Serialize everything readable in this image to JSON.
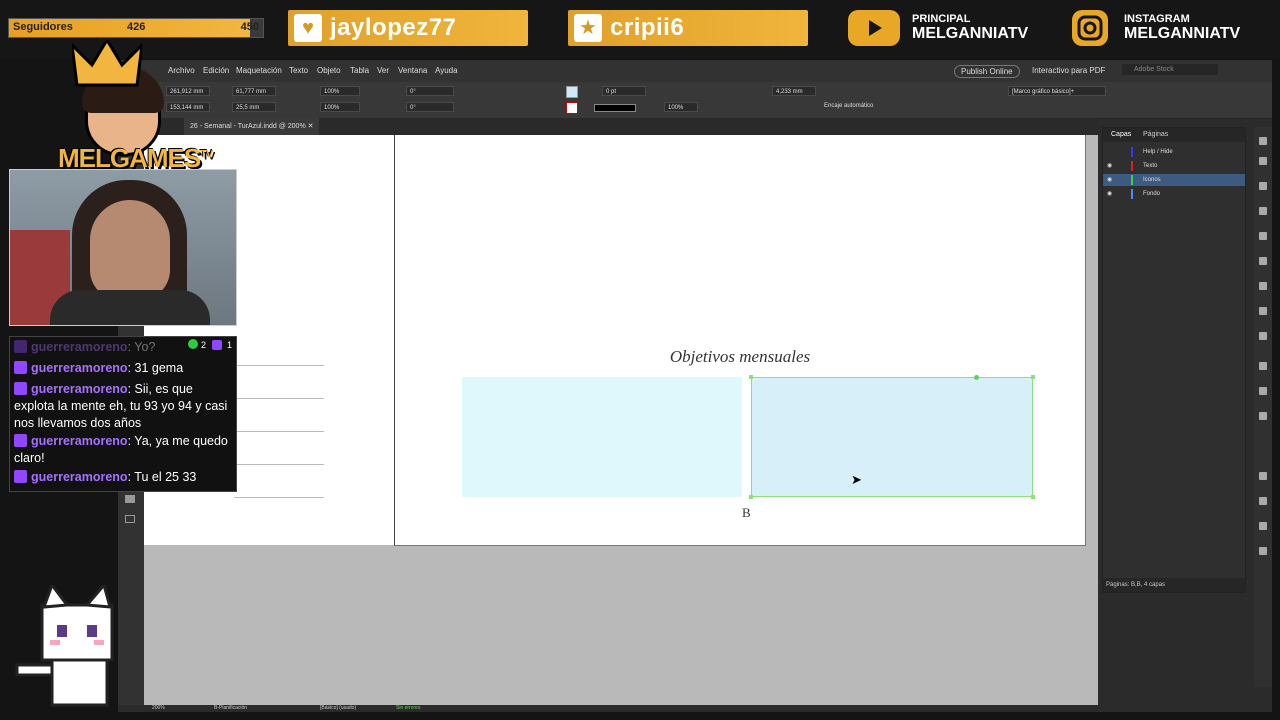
{
  "overlay": {
    "followers": {
      "label": "Seguidores",
      "current": "426",
      "goal": "450",
      "progress": 0.947
    },
    "highlight1": "jaylopez77",
    "highlight2": "cripii6",
    "youtube": {
      "sub": "PRINCIPAL",
      "main": "MELGANNIATV"
    },
    "instagram": {
      "sub": "INSTAGRAM",
      "main": "MELGANNIATV"
    },
    "logo_text": "MELGAMES",
    "logo_tv": "TV"
  },
  "chat": {
    "badges": {
      "mods": "2",
      "subs": "1"
    },
    "messages": [
      {
        "user": "guerreramoreno",
        "text": "Yo?"
      },
      {
        "user": "guerreramoreno",
        "text": "31 gema"
      },
      {
        "user": "guerreramoreno",
        "text": "Sii, es que explota la mente eh, tu 93 yo 94 y casi nos llevamos dos años"
      },
      {
        "user": "guerreramoreno",
        "text": "Ya, ya me quedo claro!"
      },
      {
        "user": "guerreramoreno",
        "text": "Tu el 25 33"
      }
    ]
  },
  "app": {
    "menu": [
      "Archivo",
      "Edición",
      "Maquetación",
      "Texto",
      "Objeto",
      "Tabla",
      "Ver",
      "Ventana",
      "Ayuda"
    ],
    "publish": "Publish Online",
    "workspace": "Interactivo para PDF",
    "search_placeholder": "Adobe Stock",
    "controls": {
      "x": "261,912 mm",
      "y": "153,144 mm",
      "w": "61,777 mm",
      "h": "25,5 mm",
      "scale_x": "100%",
      "scale_y": "100%",
      "angle": "0°",
      "shear": "0°",
      "stroke": "0 pt",
      "opacity": "100%",
      "gap": "4,233 mm",
      "autofit": "Encaje automático",
      "style": "[Marco gráfico básico]+"
    },
    "doc_tab": "26 - Semanal - TurAzul.indd @ 200%",
    "page": {
      "heading": "Objetivos mensuales",
      "label": "B"
    },
    "status": {
      "zoom": "200%",
      "page": "B-Planificación",
      "profile": "[Básico] (usado)",
      "preflight": "Sin errores"
    }
  },
  "layers_panel": {
    "tabs": [
      "Capas",
      "Páginas"
    ],
    "layers": [
      {
        "name": "Help / Hide",
        "color": "#2d3dff"
      },
      {
        "name": "Texto",
        "color": "#e02020"
      },
      {
        "name": "Iconos",
        "color": "#35d35a"
      },
      {
        "name": "Fondo",
        "color": "#4a8cff"
      }
    ],
    "footer": "Páginas: B,B, 4 capas"
  }
}
